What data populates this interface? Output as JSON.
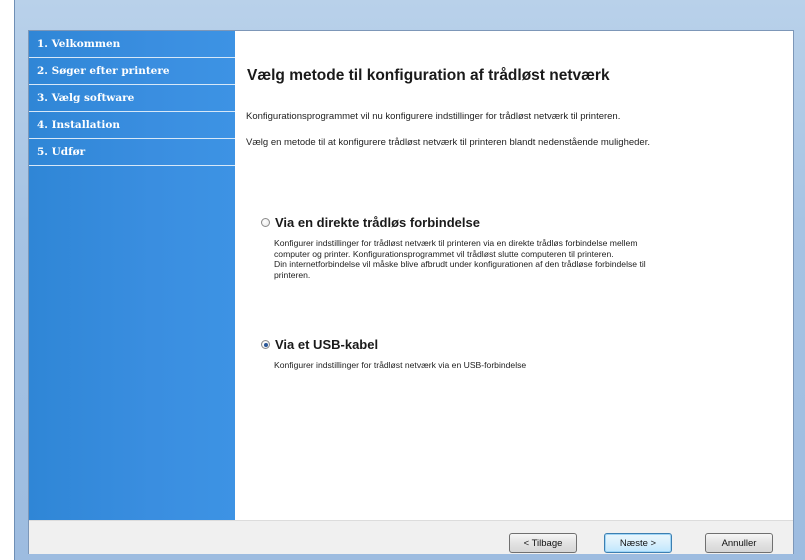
{
  "sidebar": {
    "items": [
      {
        "label": "1. Velkommen"
      },
      {
        "label": "2. Søger efter printere"
      },
      {
        "label": "3. Vælg software"
      },
      {
        "label": "4. Installation"
      },
      {
        "label": "5. Udfør"
      }
    ],
    "active_index": 4
  },
  "main": {
    "title": "Vælg metode til konfiguration af trådløst netværk",
    "intro_1": "Konfigurationsprogrammet vil nu konfigurere indstillinger for trådløst netværk til printeren.",
    "intro_2": "Vælg en metode til at konfigurere trådløst netværk til printeren blandt nedenstående muligheder.",
    "options": [
      {
        "label": "Via en direkte trådløs forbindelse",
        "selected": false,
        "description_lines": [
          "Konfigurer indstillinger for trådløst netværk til printeren via en direkte trådløs forbindelse mellem",
          "computer og printer. Konfigurationsprogrammet vil trådløst slutte computeren til printeren.",
          "Din internetforbindelse vil måske blive afbrudt under konfigurationen af den trådløse forbindelse til",
          "printeren."
        ]
      },
      {
        "label": "Via et USB-kabel",
        "selected": true,
        "description_lines": [
          "Konfigurer indstillinger for trådløst netværk via en USB-forbindelse"
        ]
      }
    ]
  },
  "footer": {
    "back_label": "< Tilbage",
    "next_label": "Næste >",
    "cancel_label": "Annuller"
  },
  "colors": {
    "sidebar": "#3a8ee0",
    "frame": "#a6c3e3"
  }
}
